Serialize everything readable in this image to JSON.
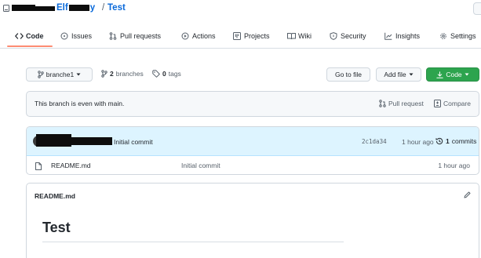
{
  "repo": {
    "owner": "Elf",
    "owner_suffix": "y",
    "separator": "/",
    "name": "Test"
  },
  "tabs": [
    {
      "label": "Code",
      "icon": "code-icon",
      "active": true
    },
    {
      "label": "Issues",
      "icon": "issue-icon"
    },
    {
      "label": "Pull requests",
      "icon": "pull-request-icon"
    },
    {
      "label": "Actions",
      "icon": "play-icon"
    },
    {
      "label": "Projects",
      "icon": "project-icon"
    },
    {
      "label": "Wiki",
      "icon": "book-icon"
    },
    {
      "label": "Security",
      "icon": "shield-icon"
    },
    {
      "label": "Insights",
      "icon": "graph-icon"
    },
    {
      "label": "Settings",
      "icon": "gear-icon"
    }
  ],
  "filenav": {
    "branch": "branche1",
    "branches_count": "2",
    "branches_label": "branches",
    "tags_count": "0",
    "tags_label": "tags",
    "go_to_file": "Go to file",
    "add_file": "Add file",
    "code_button": "Code"
  },
  "branch_info": {
    "message": "This branch is even with main.",
    "pull_request": "Pull request",
    "compare": "Compare"
  },
  "commit": {
    "message": "Initial commit",
    "hash": "2c1da34",
    "time": "1 hour ago",
    "commits_count": "1",
    "commits_label": "commits"
  },
  "files": [
    {
      "name": "README.md",
      "message": "Initial commit",
      "time": "1 hour ago"
    }
  ],
  "readme": {
    "filename": "README.md",
    "heading": "Test"
  },
  "colors": {
    "link": "#0969da",
    "tab_underline": "#fd8c73",
    "green_button": "#2da44e",
    "commit_bar": "#ddf4ff"
  }
}
